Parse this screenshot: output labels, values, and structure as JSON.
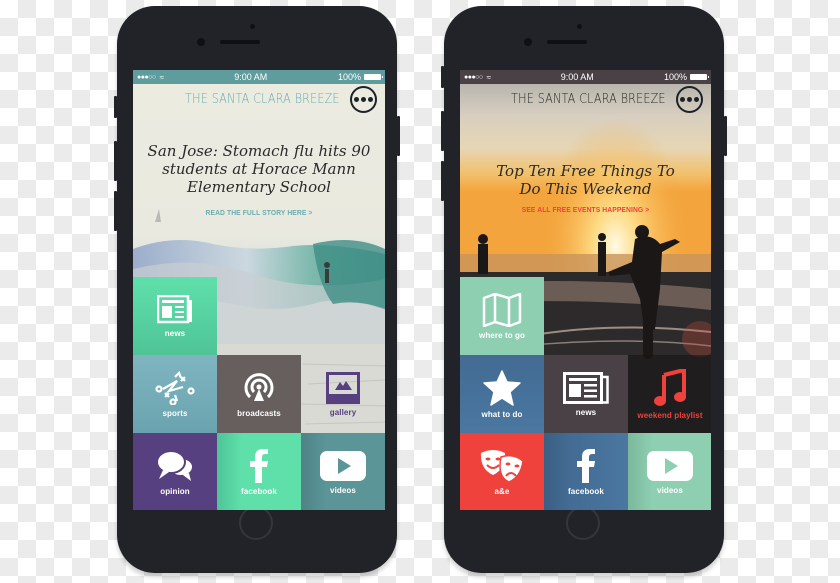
{
  "phones": [
    {
      "status": {
        "time": "9:00 AM",
        "battery": "100%",
        "signal_dots": "●●●○○"
      },
      "masthead": {
        "title": "THE SANTA CLARA BREEZE",
        "menu_icon": "ellipsis-icon"
      },
      "headline": "San Jose: Stomach flu hits 90 students at Horace Mann Elementary School",
      "cta": "READ THE FULL STORY HERE >",
      "colors": {
        "status_bar": "#5e9c9e",
        "masthead": "#6aaeb0",
        "cta": "#6aaeb0"
      },
      "tiles": [
        {
          "label": "news",
          "icon": "newspaper-icon",
          "color": "#5fe0ab"
        },
        {
          "label": "sports",
          "icon": "playbook-icon",
          "color": "#7fb5c1"
        },
        {
          "label": "broadcasts",
          "icon": "broadcast-icon",
          "color": "#675f5e"
        },
        {
          "label": "gallery",
          "icon": "picture-icon",
          "color": "#57407f"
        },
        {
          "label": "opinion",
          "icon": "speech-bubbles-icon",
          "color": "#57407f"
        },
        {
          "label": "facebook",
          "icon": "facebook-icon",
          "color": "#5fe0ab"
        },
        {
          "label": "videos",
          "icon": "play-icon",
          "color": "#5b9598"
        }
      ]
    },
    {
      "status": {
        "time": "9:00 AM",
        "battery": "100%",
        "signal_dots": "●●●○○"
      },
      "masthead": {
        "title": "THE SANTA CLARA BREEZE",
        "menu_icon": "ellipsis-icon"
      },
      "headline": "Top Ten Free Things To Do This Weekend",
      "cta": "SEE ALL FREE EVENTS HAPPENING >",
      "colors": {
        "status_bar": "#4a4147",
        "masthead": "#2a2a2a",
        "cta": "#f0423d"
      },
      "tiles": [
        {
          "label": "where to go",
          "icon": "map-icon",
          "color": "#8ecfb2"
        },
        {
          "label": "what to do",
          "icon": "star-icon",
          "color": "#436b93"
        },
        {
          "label": "news",
          "icon": "newspaper-icon",
          "color": "#4a4147"
        },
        {
          "label": "weekend playlist",
          "icon": "music-note-icon",
          "color": "#f0423d"
        },
        {
          "label": "a&e",
          "icon": "theater-masks-icon",
          "color": "#f0423d"
        },
        {
          "label": "facebook",
          "icon": "facebook-icon",
          "color": "#436b93"
        },
        {
          "label": "videos",
          "icon": "play-icon",
          "color": "#8ecfb2"
        }
      ]
    }
  ]
}
